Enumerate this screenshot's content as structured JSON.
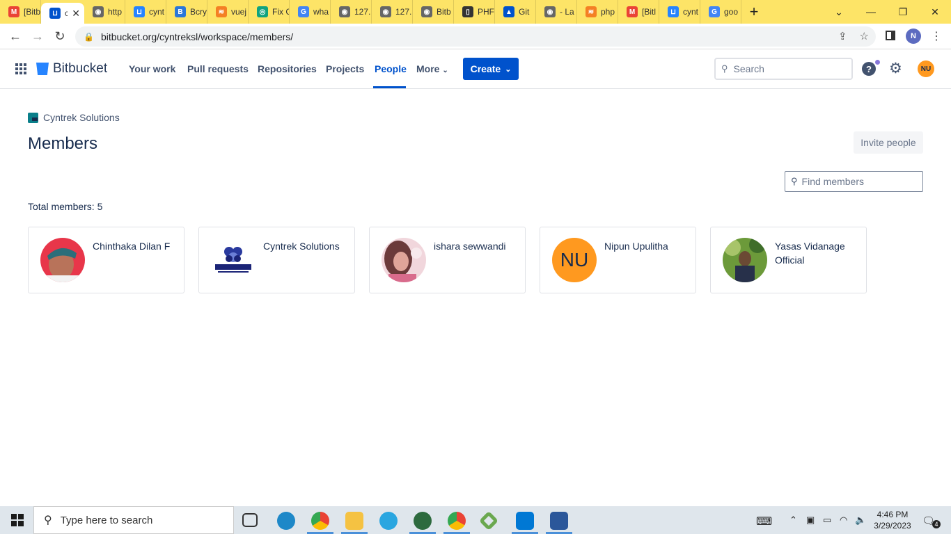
{
  "browser": {
    "tabs": [
      {
        "title": "[Bitb",
        "color": "#ea4335",
        "glyph": "M"
      },
      {
        "title": "cyn",
        "color": "#0052cc",
        "glyph": "⊔",
        "active": true
      },
      {
        "title": "http",
        "color": "#666666",
        "glyph": "◉"
      },
      {
        "title": "cynt",
        "color": "#2684ff",
        "glyph": "⊔"
      },
      {
        "title": "Bcry",
        "color": "#2a76d8",
        "glyph": "B"
      },
      {
        "title": "vuej",
        "color": "#f48024",
        "glyph": "≋"
      },
      {
        "title": "Fix C",
        "color": "#10a37f",
        "glyph": "◎"
      },
      {
        "title": "wha",
        "color": "#4285f4",
        "glyph": "G"
      },
      {
        "title": "127.",
        "color": "#666666",
        "glyph": "◉"
      },
      {
        "title": "127.",
        "color": "#666666",
        "glyph": "◉"
      },
      {
        "title": "Bitb",
        "color": "#666666",
        "glyph": "◉"
      },
      {
        "title": "PHF",
        "color": "#333333",
        "glyph": "▯"
      },
      {
        "title": "Git",
        "color": "#0052cc",
        "glyph": "▲"
      },
      {
        "title": "- La",
        "color": "#666666",
        "glyph": "◉"
      },
      {
        "title": "php",
        "color": "#f48024",
        "glyph": "≋"
      },
      {
        "title": "[Bitl",
        "color": "#ea4335",
        "glyph": "M"
      },
      {
        "title": "cynt",
        "color": "#2684ff",
        "glyph": "⊔"
      },
      {
        "title": "goo",
        "color": "#4285f4",
        "glyph": "G"
      }
    ],
    "new_tab": "+",
    "url": "bitbucket.org/cyntreksl/workspace/members/",
    "profile_initial": "N"
  },
  "header": {
    "brand": "Bitbucket",
    "nav": [
      "Your work",
      "Pull requests",
      "Repositories",
      "Projects",
      "People",
      "More"
    ],
    "create_label": "Create",
    "search_placeholder": "Search",
    "help_glyph": "?",
    "user_initials": "NU"
  },
  "page": {
    "workspace": "Cyntrek Solutions",
    "title": "Members",
    "invite_label": "Invite people",
    "find_placeholder": "Find members",
    "total_label": "Total members: 5"
  },
  "members": [
    {
      "name": "Chinthaka Dilan F",
      "avatar": "photo-red"
    },
    {
      "name": "Cyntrek Solutions",
      "avatar": "logo-cyntrek"
    },
    {
      "name": "ishara sewwandi",
      "avatar": "photo-pink"
    },
    {
      "name": "Nipun Upulitha",
      "avatar": "initials",
      "initials": "NU"
    },
    {
      "name": "Yasas Vidanage Official",
      "avatar": "photo-green"
    }
  ],
  "taskbar": {
    "search_placeholder": "Type here to search",
    "time": "4:46 PM",
    "date": "3/29/2023",
    "notification_count": "4"
  },
  "colors": {
    "brand_blue": "#0052cc",
    "tabstrip": "#fde467",
    "avatar_orange": "#ff991f"
  }
}
